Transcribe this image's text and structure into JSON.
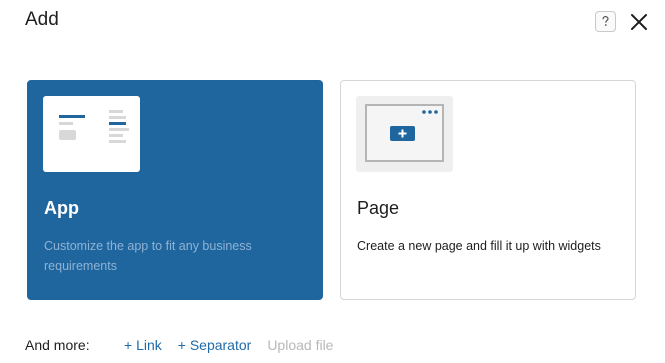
{
  "header": {
    "title": "Add",
    "help_icon": "help-question-icon",
    "close_icon": "close-x-icon"
  },
  "cards": [
    {
      "id": "app",
      "name": "App",
      "description": "Customize the app to fit any business requirements",
      "selected": true,
      "thumbnail_icon": "app-layout-thumbnail"
    },
    {
      "id": "page",
      "name": "Page",
      "description": "Create a new page and fill it up with widgets",
      "selected": false,
      "thumbnail_icon": "page-add-thumbnail"
    }
  ],
  "more": {
    "label": "And more:",
    "link_label": "+ Link",
    "separator_label": "+ Separator",
    "upload_label": "Upload file",
    "upload_disabled": true
  },
  "colors": {
    "accent": "#1f669f",
    "link": "#1f6aa8",
    "disabled": "#b8b8b8"
  }
}
